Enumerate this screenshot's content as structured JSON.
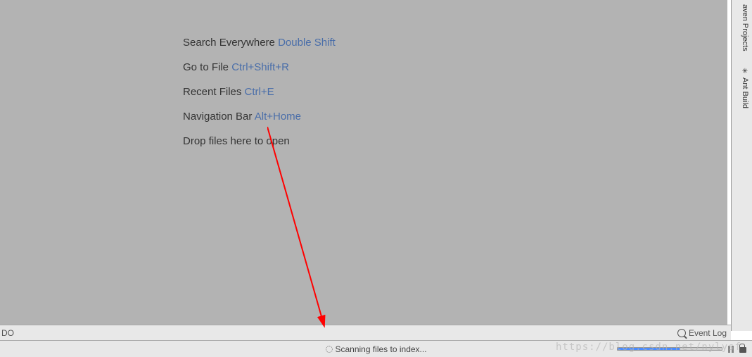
{
  "tips": [
    {
      "label": "Search Everywhere",
      "shortcut": "Double Shift"
    },
    {
      "label": "Go to File",
      "shortcut": "Ctrl+Shift+R"
    },
    {
      "label": "Recent Files",
      "shortcut": "Ctrl+E"
    },
    {
      "label": "Navigation Bar",
      "shortcut": "Alt+Home"
    },
    {
      "label": "Drop files here to open",
      "shortcut": ""
    }
  ],
  "rightTabs": {
    "maven": "aven Projects",
    "ant": "Ant Build"
  },
  "bottomBar": {
    "left": "DO",
    "eventLog": "Event Log"
  },
  "status": {
    "text": "Scanning files to index..."
  },
  "watermark": "https://blog.csdn.net/nylysf"
}
